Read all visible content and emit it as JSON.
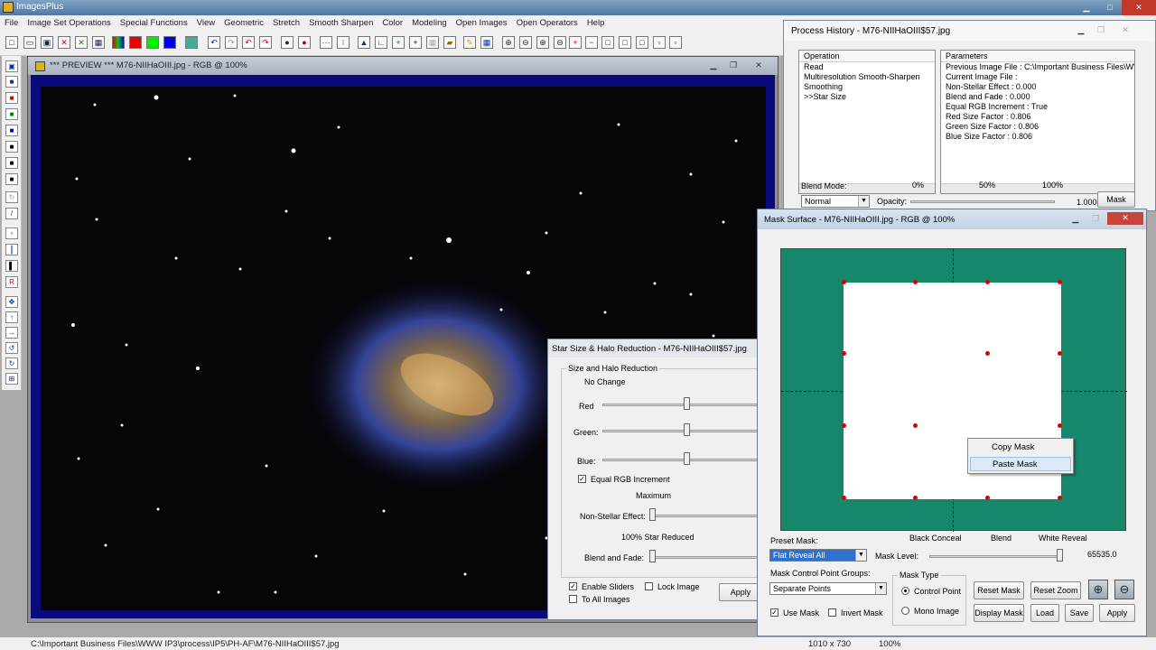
{
  "app": {
    "title": "ImagesPlus"
  },
  "menu": [
    "File",
    "Image Set Operations",
    "Special Functions",
    "View",
    "Geometric",
    "Stretch",
    "Smooth Sharpen",
    "Color",
    "Modeling",
    "Open Images",
    "Open Operators",
    "Help"
  ],
  "preview": {
    "title": "*** PREVIEW *** M76-NIIHaOIII.jpg - RGB @ 100%"
  },
  "status": {
    "path": "C:\\Important Business Files\\WWW IP3\\process\\IP5\\PH-AF\\M76-NIIHaOIII$57.jpg",
    "size": "1010 x 730",
    "zoom": "100%"
  },
  "history": {
    "title": "Process History - M76-NIIHaOIII$57.jpg",
    "op_header": "Operation",
    "operations": [
      "Read",
      "Multiresolution Smooth-Sharpen",
      "Smoothing",
      ">>Star Size"
    ],
    "param_header": "Parameters",
    "parameters": [
      "Previous Image File : C:\\Important Business Files\\WWW...",
      "Current Image File :",
      "Non-Stellar Effect : 0.000",
      "Blend and Fade : 0.000",
      "Equal RGB Increment : True",
      "Red Size Factor : 0.806",
      "Green Size Factor : 0.806",
      "Blue Size Factor : 0.806"
    ],
    "blend_mode_label": "Blend Mode:",
    "blend_mode_value": "Normal",
    "opacity_label": "Opacity:",
    "tick_0": "0%",
    "tick_50": "50%",
    "tick_100": "100%",
    "opacity_value": "1.000",
    "mask_button": "Mask"
  },
  "starsize": {
    "title": "Star Size & Halo Reduction - M76-NIIHaOIII$57.jpg",
    "group_title": "Size and Halo Reduction",
    "no_change": "No Change",
    "red": "Red",
    "green": "Green:",
    "blue": "Blue:",
    "equal_rgb": "Equal RGB Increment",
    "maximum": "Maximum",
    "non_stellar": "Non-Stellar Effect:",
    "star_reduced": "100% Star Reduced",
    "blend_fade": "Blend and Fade:",
    "enable_sliders": "Enable Sliders",
    "lock_image": "Lock Image",
    "to_all_images": "To All Images",
    "apply": "Apply",
    "equal_rgb_checked": true,
    "enable_sliders_checked": true,
    "lock_image_checked": false,
    "to_all_checked": false
  },
  "mask": {
    "title": "Mask Surface - M76-NIIHaOIII.jpg - RGB @ 100%",
    "context_menu": [
      "Copy Mask",
      "Paste Mask"
    ],
    "preset_label": "Preset Mask:",
    "preset_value": "Flat Reveal All",
    "black_conceal": "Black Conceal",
    "blend": "Blend",
    "white_reveal": "White Reveal",
    "mask_level_label": "Mask Level:",
    "mask_level_value": "65535.0",
    "cp_groups_label": "Mask Control Point Groups:",
    "cp_groups_value": "Separate Points",
    "mask_type_label": "Mask Type",
    "control_point": "Control Point",
    "mono_image": "Mono Image",
    "use_mask": "Use Mask",
    "invert_mask": "Invert Mask",
    "reset_mask": "Reset Mask",
    "reset_zoom": "Reset Zoom",
    "display_mask": "Display Mask",
    "load": "Load",
    "save": "Save",
    "apply": "Apply"
  }
}
